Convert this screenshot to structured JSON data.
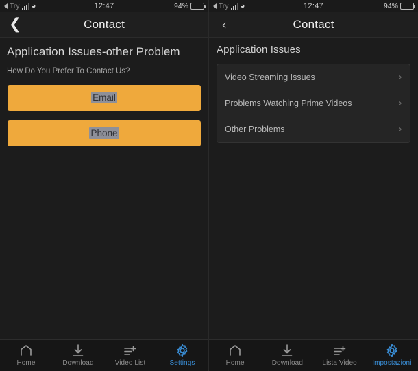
{
  "status_bar": {
    "carrier": "Try",
    "time": "12:47",
    "battery_percent": "94%",
    "signal_icon": "cellular-signal-icon",
    "wifi_icon": "wifi-icon",
    "battery_icon": "battery-icon",
    "back_arrow_icon": "status-back-arrow-icon"
  },
  "colors": {
    "accent_orange": "#efa93c",
    "accent_blue": "#3a8fd8",
    "background": "#1c1c1c",
    "list_background": "#252525",
    "titlebar": "#1f1f1f",
    "tabbar": "#161616"
  },
  "left_panel": {
    "titlebar": {
      "title": "Contact",
      "back_icon": "chevron-left-icon"
    },
    "heading": "Application Issues-other Problem",
    "subtitle": "How Do You Prefer To Contact Us?",
    "buttons": [
      {
        "label": "Email",
        "name": "email-button"
      },
      {
        "label": "Phone",
        "name": "phone-button"
      }
    ],
    "tabs": [
      {
        "label": "Home",
        "icon": "home-icon",
        "active": false
      },
      {
        "label": "Download",
        "icon": "download-icon",
        "active": false
      },
      {
        "label": "Video List",
        "icon": "add-to-list-icon",
        "active": false
      },
      {
        "label": "Settings",
        "icon": "gear-icon",
        "active": true
      }
    ]
  },
  "right_panel": {
    "titlebar": {
      "title": "Contact",
      "back_icon": "chevron-left-icon"
    },
    "heading": "Application Issues",
    "list_items": [
      {
        "label": "Video Streaming Issues",
        "chevron": "›"
      },
      {
        "label": "Problems Watching Prime Videos",
        "chevron": "›"
      },
      {
        "label": "Other Problems",
        "chevron": "›"
      }
    ],
    "tabs": [
      {
        "label": "Home",
        "icon": "home-icon",
        "active": false
      },
      {
        "label": "Download",
        "icon": "download-icon",
        "active": false
      },
      {
        "label": "Lista Video",
        "icon": "add-to-list-icon",
        "active": false
      },
      {
        "label": "Impostazioni",
        "icon": "gear-icon",
        "active": true
      }
    ]
  }
}
